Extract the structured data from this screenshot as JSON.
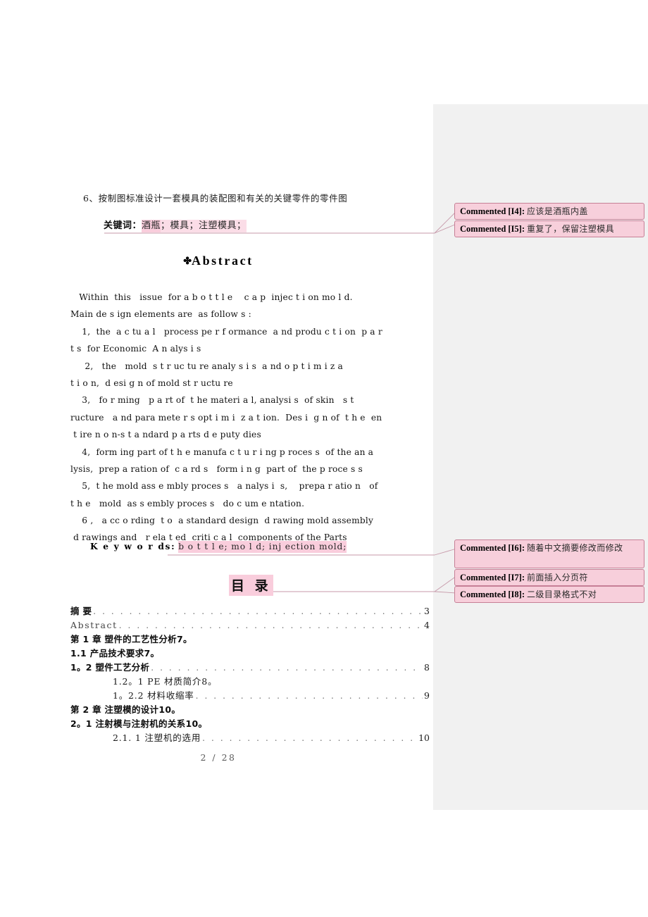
{
  "page": {
    "footer": "2 / 28",
    "highlight_color": "#f9cddc",
    "comment_fill": "#f7cfdb",
    "comment_border": "#c67f96",
    "gutter_color": "#f1f1f1"
  },
  "chinese_tail": {
    "item6": "6、按制图标准设计一套模具的装配图和有关的关键零件的零件图",
    "keywords_label": "关键词：",
    "keywords_hl_a": "酒瓶",
    "keywords_hl_b": "；模具；注塑模具；"
  },
  "abstract": {
    "anchor_mark": "✤",
    "heading": "Abstract",
    "lines": [
      "   Within  this   issue  for a b o t t l e    c a p  injec t i on mo l d.",
      "Main de s ign elements are  as follow s :",
      "    1,  the  a c tu a l   process pe r f ormance  a nd produ c t i on  p a r",
      "t s  for Economic  A n alys i s",
      "     2,   the   mold  s t r uc tu re analy s i s  a nd o p t i m i z a",
      "t i o n,  d esi g n of mold st r uctu re",
      "    3,   fo r ming   p a rt of  t he materi a l, analysi s  of skin   s t",
      "ructure   a nd para mete r s opt i m i  z a t ion.  Des i  g n of  t h e  en",
      " t ire n o n-s t a ndard p a rts d e puty dies",
      "    4,  form ing part of t h e manufa c t u r i ng p roces s  of the an a",
      "lysis,  prep a ration of  c a rd s   form i n g  part of  the p roce s s",
      "    5,  t he mold ass e mbly proces s   a nalys i  s,    prepa r atio n   of",
      "t h e   mold  as s embly proces s   do c um e ntation.",
      "    6 ,   a cc o rding  t o  a standard design  d rawing mold assembly",
      " d rawings and   r ela t ed  criti c a l  components of the Parts"
    ],
    "keywords_label": "K e y w o r ds:",
    "keywords_hl": "b o t t l e;  mo l d;  inj ection mold;"
  },
  "toc": {
    "heading": "目 录",
    "rows": [
      {
        "label": "摘  要",
        "page": "3",
        "style": "bold",
        "indent": 0,
        "dots": true
      },
      {
        "label": "Abstract",
        "page": "4",
        "style": "mono",
        "indent": 0,
        "dots": true
      },
      {
        "label": "第 1 章   塑件的工艺性分析7。",
        "page": "",
        "style": "bold",
        "indent": 0,
        "dots": false
      },
      {
        "label": "1.1 产品技术要求7。",
        "page": "",
        "style": "bold",
        "indent": 0,
        "dots": false
      },
      {
        "label": "1。2 塑件工艺分析",
        "page": "8",
        "style": "bold",
        "indent": 0,
        "dots": true
      },
      {
        "label": "1.2。1 PE 材质简介8。",
        "page": "",
        "style": "serif",
        "indent": 2,
        "dots": false
      },
      {
        "label": "1。2.2  材料收缩率",
        "page": "9",
        "style": "serif",
        "indent": 2,
        "dots": true
      },
      {
        "label": "第 2 章   注塑模的设计10。",
        "page": "",
        "style": "bold",
        "indent": 0,
        "dots": false
      },
      {
        "label": "2。1   注射模与注射机的关系10。",
        "page": "",
        "style": "bold",
        "indent": 0,
        "dots": false
      },
      {
        "label": "2.1. 1 注塑机的选用",
        "page": "10",
        "style": "serif",
        "indent": 2,
        "dots": true
      }
    ]
  },
  "comments": [
    {
      "tag": "Commented [I4]:",
      "text": "应该是酒瓶内盖"
    },
    {
      "tag": "Commented [I5]:",
      "text": "重复了，保留注塑模具"
    },
    {
      "tag": "Commented [I6]:",
      "text": "随着中文摘要修改而修改"
    },
    {
      "tag": "Commented [I7]:",
      "text": "前面插入分页符"
    },
    {
      "tag": "Commented [I8]:",
      "text": "二级目录格式不对"
    }
  ]
}
